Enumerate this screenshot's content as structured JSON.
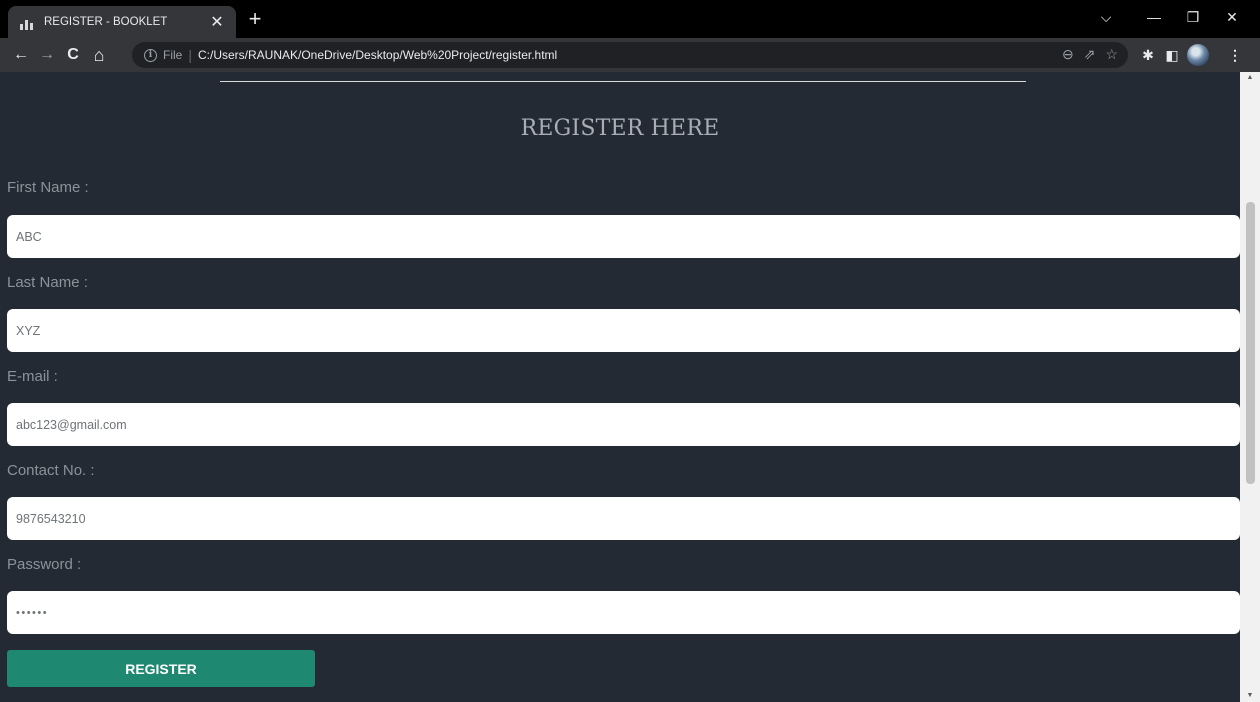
{
  "browser": {
    "tab_title": "REGISTER - BOOKLET",
    "tab_close": "✕",
    "new_tab": "+",
    "url_scheme": "File",
    "url_separator": "|",
    "url": "C:/Users/RAUNAK/OneDrive/Desktop/Web%20Project/register.html",
    "icons": {
      "back": "←",
      "forward": "→",
      "reload": "C",
      "home": "⌂",
      "zoom": "⊖",
      "share": "⇗",
      "bookmark": "☆",
      "extensions": "✱",
      "sidepanel": "◧",
      "menu": "⋮",
      "minimize": "—",
      "restore": "❐",
      "close": "✕",
      "tab_search": "⌵"
    }
  },
  "page": {
    "title": "REGISTER HERE",
    "fields": [
      {
        "label": "First Name :",
        "value": "ABC"
      },
      {
        "label": "Last Name :",
        "value": "XYZ"
      },
      {
        "label": "E-mail :",
        "value": "abc123@gmail.com"
      },
      {
        "label": "Contact No. :",
        "value": "9876543210"
      },
      {
        "label": "Password :",
        "value": "••••••"
      }
    ],
    "register_button": "REGISTER"
  },
  "colors": {
    "page_background": "#232a33",
    "button": "#1f8870",
    "label": "#8c929a"
  }
}
